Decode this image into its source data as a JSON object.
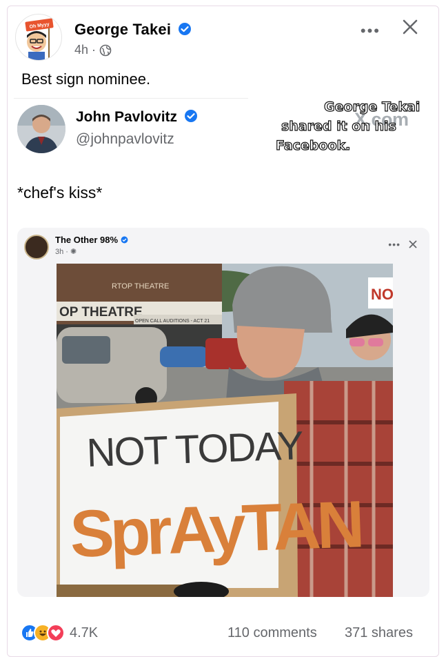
{
  "post": {
    "author": "George Takei",
    "time": "4h",
    "caption": "Best sign nominee.",
    "avatar_sign": "Oh Myyy"
  },
  "tweet": {
    "name": "John Pavlovitz",
    "handle": "@johnpavlovitz",
    "text": "*chef's kiss*"
  },
  "overlay": {
    "line1": "George Tekai",
    "line2": "shared it on his",
    "line3": "Facebook.",
    "watermark": "X.com"
  },
  "inner_post": {
    "name": "The Other 98%",
    "time": "3h"
  },
  "photo": {
    "theatre_sign": "OP THEATRE",
    "roof_sign": "RTOP THEATRE",
    "marquee": "OPEN CALL AUDITIONS - ACT 21",
    "sign_line1": "NOT TODAY",
    "sign_line2": "SprAyTAN",
    "small_sign": "NO"
  },
  "footer": {
    "reaction_count": "4.7K",
    "comments": "110 comments",
    "shares": "371 shares"
  },
  "colors": {
    "verified": "#1877f2",
    "meta_gray": "#65676b",
    "sign_orange": "#d9803a",
    "sign_ink": "#3a3a3a"
  }
}
